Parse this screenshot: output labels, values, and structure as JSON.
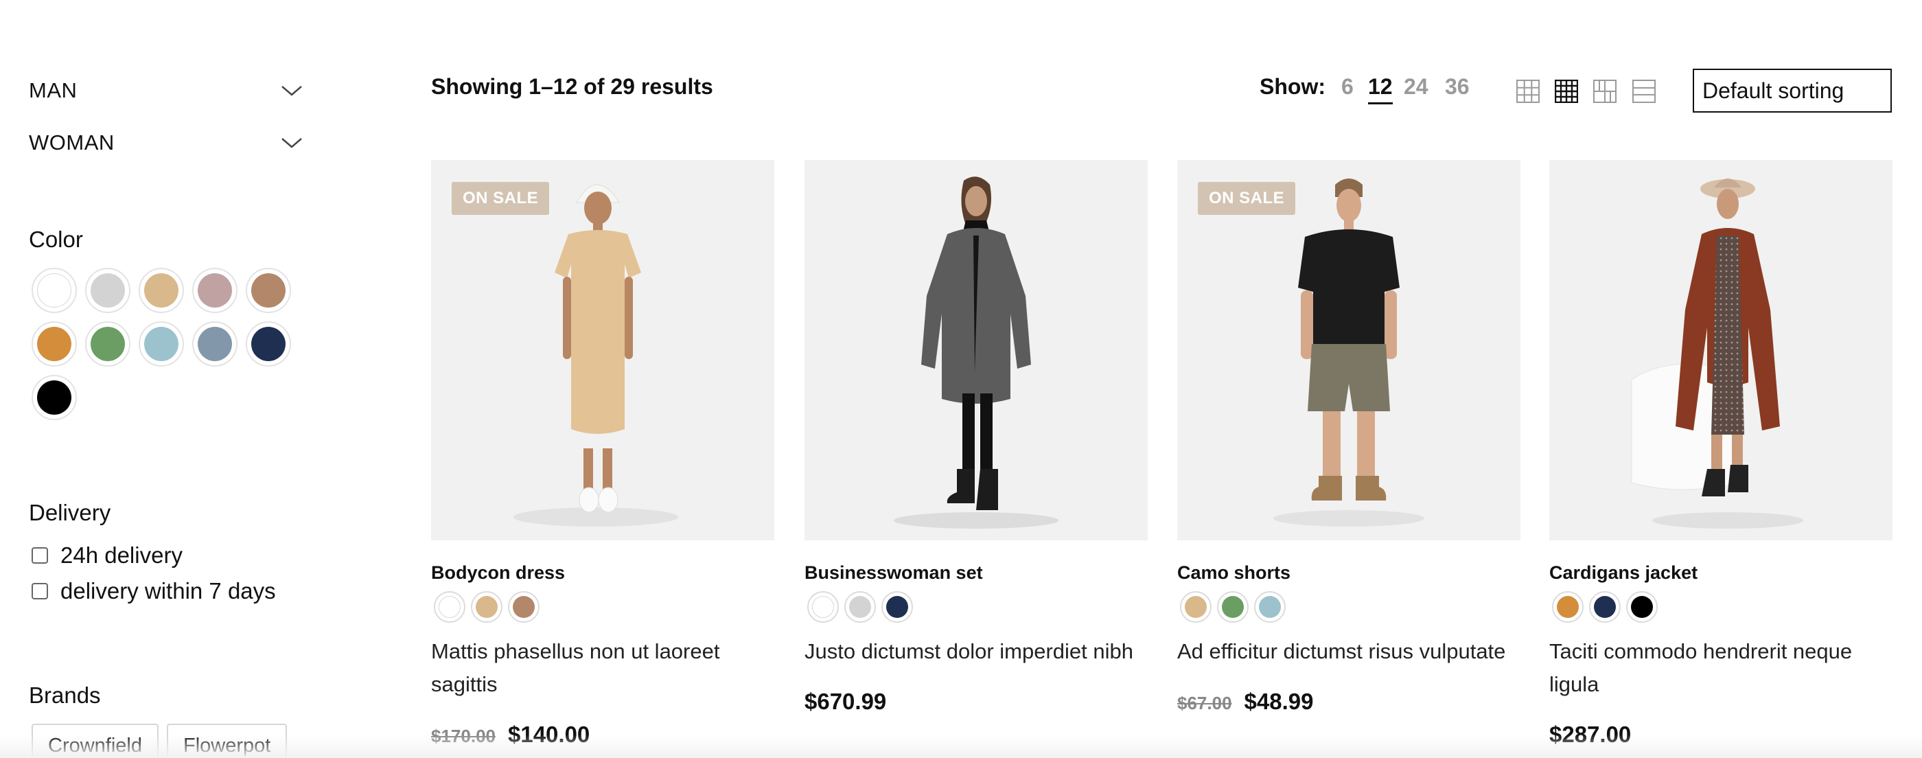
{
  "sidebar": {
    "categories": [
      {
        "label": "MAN"
      },
      {
        "label": "WOMAN"
      }
    ],
    "color_title": "Color",
    "colors": [
      "#ffffff",
      "#d3d3d3",
      "#d9b88b",
      "#c0a2a2",
      "#b3876a",
      "#d48d3a",
      "#6a9e63",
      "#9cc3cd",
      "#8297aa",
      "#1f2f52",
      "#000000"
    ],
    "delivery_title": "Delivery",
    "delivery_options": [
      {
        "label": "24h delivery",
        "checked": false
      },
      {
        "label": "delivery within 7 days",
        "checked": false
      }
    ],
    "brands_title": "Brands",
    "brands": [
      "Crownfield",
      "Flowerpot"
    ]
  },
  "toolbar": {
    "result_count": "Showing 1–12 of 29 results",
    "show_label": "Show:",
    "show_options": [
      "6",
      "12",
      "24",
      "36"
    ],
    "show_selected": "12",
    "view_modes": [
      "grid-3-icon",
      "grid-4-icon",
      "grid-2-icon",
      "list-icon"
    ],
    "view_selected": "grid-4-icon",
    "sort_selected": "Default sorting"
  },
  "products": [
    {
      "name": "Bodycon dress",
      "badge": "ON SALE",
      "colors": [
        "#ffffff",
        "#d9b88b",
        "#b3876a"
      ],
      "description": "Mattis phasellus non ut laoreet sagittis",
      "old_price": "$170.00",
      "price": "$140.00",
      "image": "woman-beige-dress-photo"
    },
    {
      "name": "Businesswoman set",
      "badge": "",
      "colors": [
        "#ffffff",
        "#d3d3d3",
        "#1f2f52"
      ],
      "description": "Justo dictumst dolor imperdiet nibh",
      "old_price": "",
      "price": "$670.99",
      "image": "woman-grey-coat-photo"
    },
    {
      "name": "Camo shorts",
      "badge": "ON SALE",
      "colors": [
        "#d9b88b",
        "#6a9e63",
        "#9cc3cd"
      ],
      "description": "Ad efficitur dictumst risus vulputate",
      "old_price": "$67.00",
      "price": "$48.99",
      "image": "man-black-shirt-shorts-photo"
    },
    {
      "name": "Cardigans jacket",
      "badge": "",
      "colors": [
        "#d48d3a",
        "#1f2f52",
        "#000000"
      ],
      "description": "Taciti commodo hendrerit neque ligula",
      "old_price": "",
      "price": "$287.00",
      "image": "woman-brown-trench-coat-photo"
    }
  ]
}
